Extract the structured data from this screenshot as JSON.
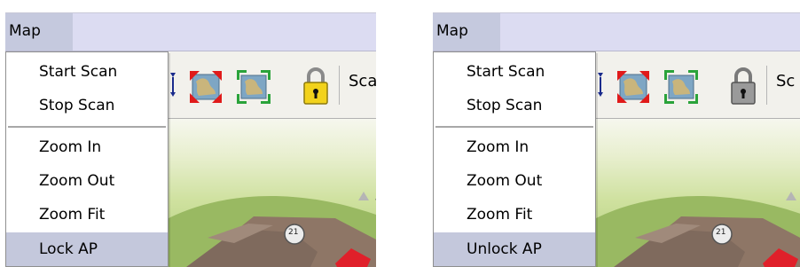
{
  "panels": [
    {
      "menubar": {
        "title": "Map"
      },
      "menu": {
        "items": [
          "Start Scan",
          "Stop Scan",
          "Zoom In",
          "Zoom Out",
          "Zoom Fit",
          "Lock AP"
        ],
        "highlighted": "Lock AP"
      },
      "toolbar": {
        "icons": [
          "scan-arrows-icon",
          "expand-map-icon",
          "fit-map-icon",
          "unlocked-padlock-icon"
        ],
        "label": "Sca"
      },
      "map": {
        "badge": "21"
      }
    },
    {
      "menubar": {
        "title": "Map"
      },
      "menu": {
        "items": [
          "Start Scan",
          "Stop Scan",
          "Zoom In",
          "Zoom Out",
          "Zoom Fit",
          "Unlock AP"
        ],
        "highlighted": "Unlock AP"
      },
      "toolbar": {
        "icons": [
          "scan-arrows-icon",
          "expand-map-icon",
          "fit-map-icon",
          "locked-padlock-icon"
        ],
        "label": "Sc"
      },
      "map": {
        "badge": "21"
      }
    }
  ],
  "colors": {
    "menubar": "#dcdcf2",
    "menu_highlight": "#c4c8dc",
    "lock_yellow": "#f2d21c",
    "lock_gray": "#9a9a9a"
  }
}
